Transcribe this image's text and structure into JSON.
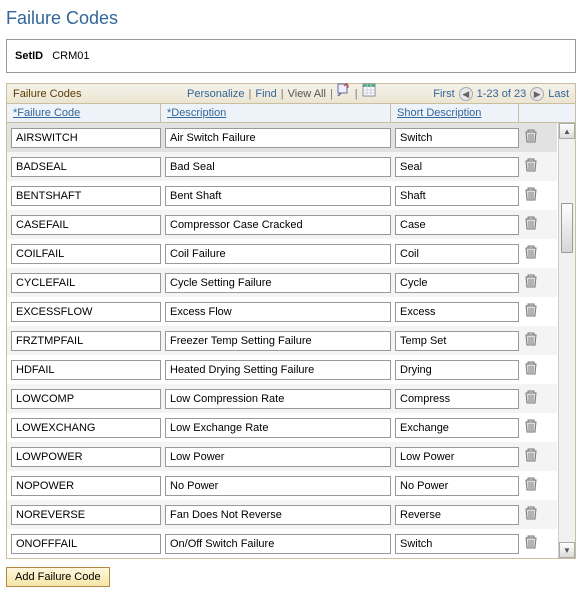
{
  "page_title": "Failure Codes",
  "setid": {
    "label": "SetID",
    "value": "CRM01"
  },
  "grid": {
    "title": "Failure Codes",
    "toolbar": {
      "personalize": "Personalize",
      "find": "Find",
      "view_all": "View All",
      "first": "First",
      "last": "Last",
      "range": "1-23 of 23"
    },
    "columns": {
      "code": "*Failure Code",
      "desc": "*Description",
      "short": "Short Description"
    },
    "rows": [
      {
        "code": "AIRSWITCH",
        "desc": "Air Switch Failure",
        "short": "Switch"
      },
      {
        "code": "BADSEAL",
        "desc": "Bad Seal",
        "short": "Seal"
      },
      {
        "code": "BENTSHAFT",
        "desc": "Bent Shaft",
        "short": "Shaft"
      },
      {
        "code": "CASEFAIL",
        "desc": "Compressor Case Cracked",
        "short": "Case"
      },
      {
        "code": "COILFAIL",
        "desc": "Coil Failure",
        "short": "Coil"
      },
      {
        "code": "CYCLEFAIL",
        "desc": "Cycle Setting Failure",
        "short": "Cycle"
      },
      {
        "code": "EXCESSFLOW",
        "desc": "Excess Flow",
        "short": "Excess"
      },
      {
        "code": "FRZTMPFAIL",
        "desc": "Freezer Temp Setting Failure",
        "short": "Temp Set"
      },
      {
        "code": "HDFAIL",
        "desc": "Heated Drying Setting Failure",
        "short": "Drying"
      },
      {
        "code": "LOWCOMP",
        "desc": "Low Compression Rate",
        "short": "Compress"
      },
      {
        "code": "LOWEXCHANG",
        "desc": "Low Exchange Rate",
        "short": "Exchange"
      },
      {
        "code": "LOWPOWER",
        "desc": "Low Power",
        "short": "Low Power"
      },
      {
        "code": "NOPOWER",
        "desc": "No Power",
        "short": "No Power"
      },
      {
        "code": "NOREVERSE",
        "desc": "Fan Does Not Reverse",
        "short": "Reverse"
      },
      {
        "code": "ONOFFFAIL",
        "desc": "On/Off Switch Failure",
        "short": "Switch"
      }
    ]
  },
  "add_button": "Add Failure Code"
}
